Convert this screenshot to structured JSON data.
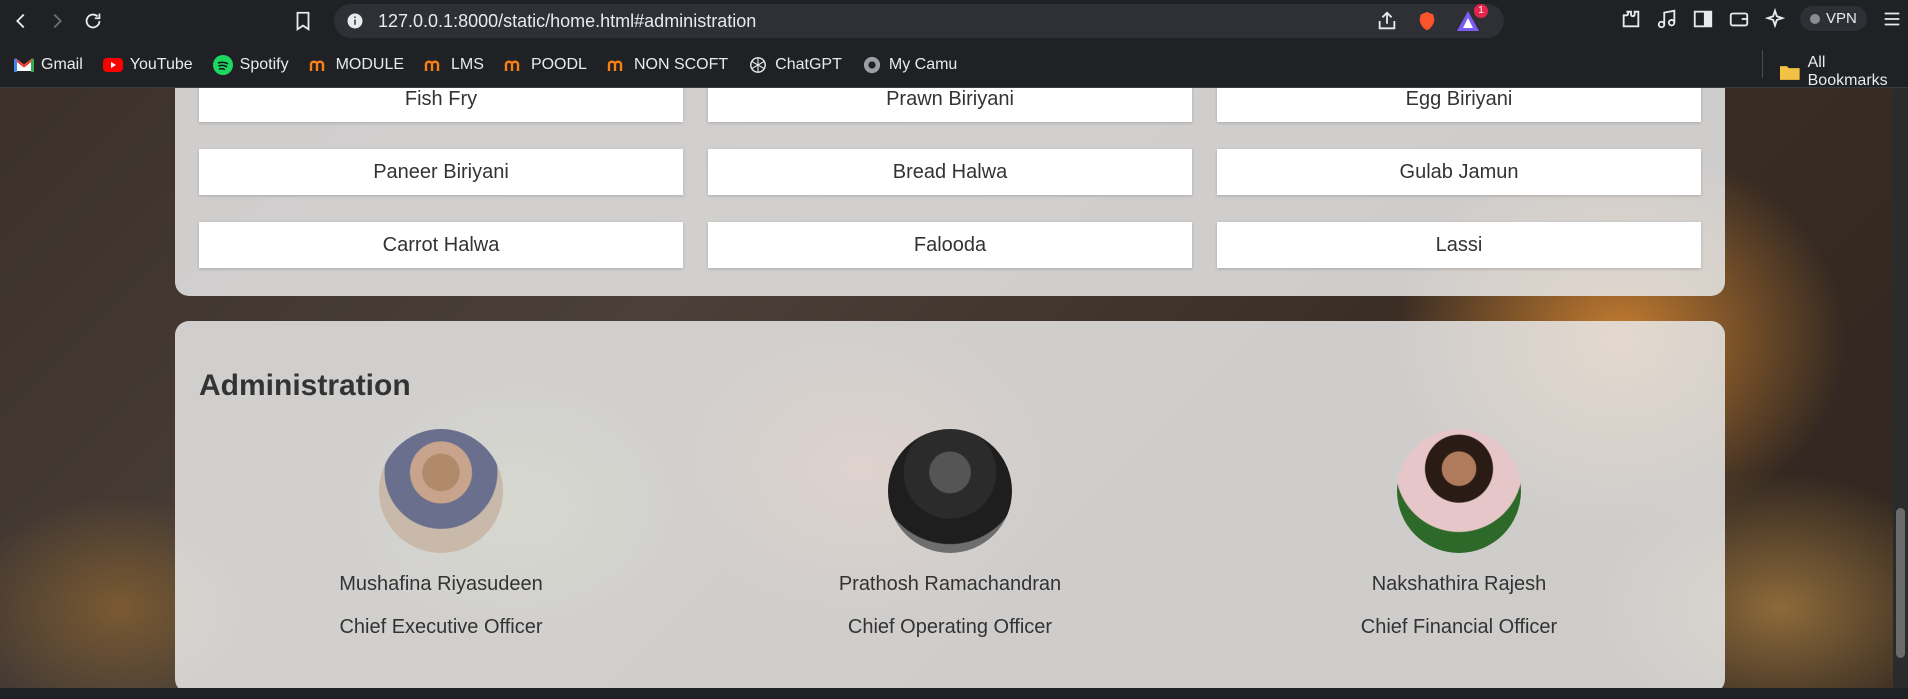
{
  "browser": {
    "url": "127.0.0.1:8000/static/home.html#administration",
    "notification_count": "1",
    "vpn_label": "VPN"
  },
  "bookmarks": {
    "items": [
      {
        "label": "Gmail",
        "icon": "gmail-icon"
      },
      {
        "label": "YouTube",
        "icon": "youtube-icon"
      },
      {
        "label": "Spotify",
        "icon": "spotify-icon"
      },
      {
        "label": "MODULE",
        "icon": "moodle-icon"
      },
      {
        "label": "LMS",
        "icon": "moodle-icon"
      },
      {
        "label": "POODL",
        "icon": "moodle-icon"
      },
      {
        "label": "NON SCOFT",
        "icon": "moodle-icon"
      },
      {
        "label": "ChatGPT",
        "icon": "chatgpt-icon"
      },
      {
        "label": "My Camu",
        "icon": "globe-icon"
      }
    ],
    "all_bookmarks": "All Bookmarks"
  },
  "menu": {
    "items": [
      "Fish Fry",
      "Prawn Biriyani",
      "Egg Biriyani",
      "Paneer Biriyani",
      "Bread Halwa",
      "Gulab Jamun",
      "Carrot Halwa",
      "Falooda",
      "Lassi"
    ]
  },
  "administration": {
    "title": "Administration",
    "members": [
      {
        "name": "Mushafina Riyasudeen",
        "role": "Chief Executive Officer"
      },
      {
        "name": "Prathosh Ramachandran",
        "role": "Chief Operating Officer"
      },
      {
        "name": "Nakshathira Rajesh",
        "role": "Chief Financial Officer"
      }
    ]
  },
  "colors": {
    "chrome_bg": "#202124",
    "panel_bg": "#e8e8e8",
    "text": "#333333",
    "badge": "#e3264a"
  }
}
